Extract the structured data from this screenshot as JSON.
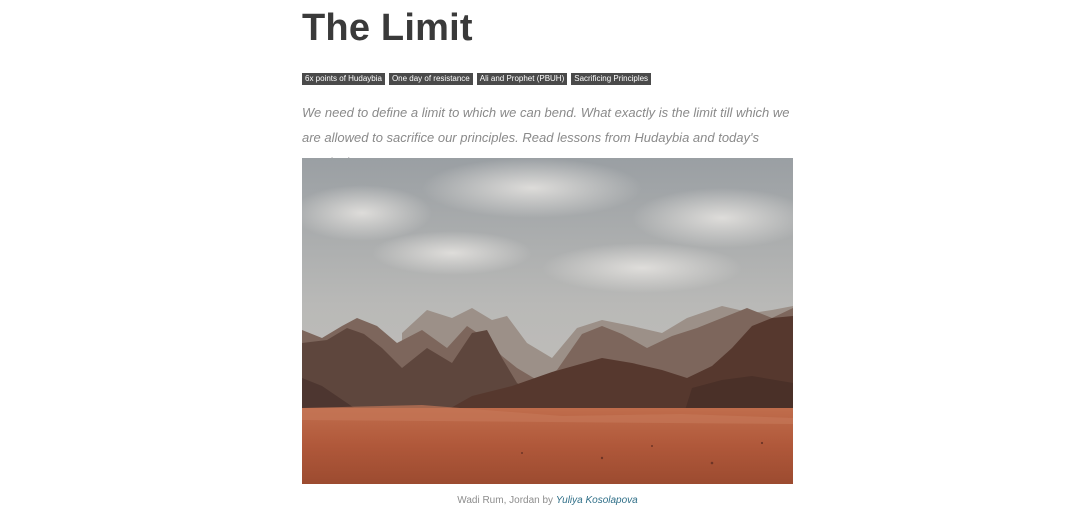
{
  "article": {
    "title": "The Limit",
    "tags": [
      {
        "label": "6x points of Hudaybia"
      },
      {
        "label": "One day of resistance"
      },
      {
        "label": "Ali and Prophet (PBUH)"
      },
      {
        "label": "Sacrificing Principles"
      }
    ],
    "excerpt": "We need to define a limit to which we can bend. What exactly is the limit till which we are allowed to sacrifice our principles. Read lessons from Hudaybia and today's conclusion.",
    "image": {
      "caption_prefix": "Wadi Rum, Jordan by ",
      "credit": "Yuliya Kosolapova"
    }
  },
  "colors": {
    "title": "#3a3a3a",
    "tag_bg": "#4a4a4a",
    "excerpt": "#8a8a8a",
    "credit_link": "#2f6f88",
    "sand": "#b0583a"
  }
}
